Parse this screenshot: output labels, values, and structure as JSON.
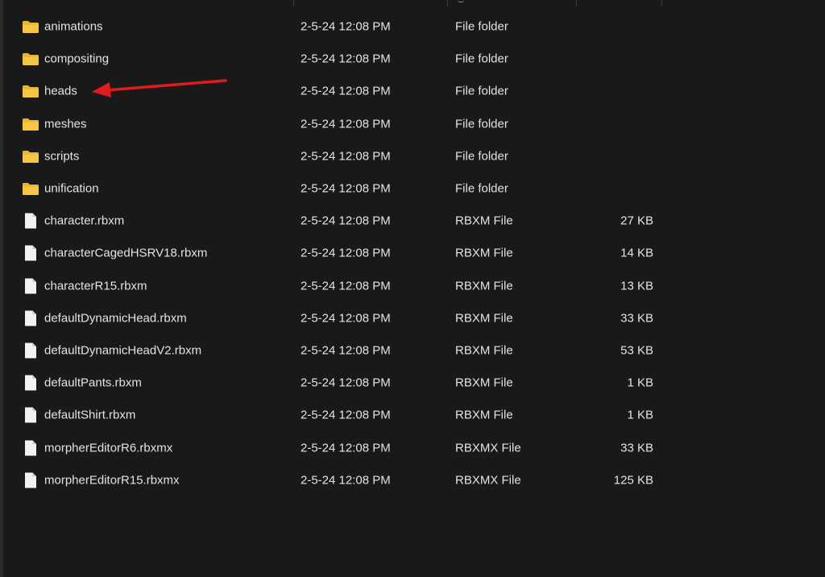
{
  "colors": {
    "background": "#191919",
    "text": "#e3e3e3",
    "folder_icon": "#f3c744",
    "file_icon": "#f2f2f2",
    "annotation_arrow": "#e01b1b"
  },
  "annotation": {
    "type": "arrow",
    "points_to": "heads"
  },
  "files": [
    {
      "name": "animations",
      "date": "2-5-24 12:08 PM",
      "type": "File folder",
      "size": "",
      "icon": "folder-icon"
    },
    {
      "name": "compositing",
      "date": "2-5-24 12:08 PM",
      "type": "File folder",
      "size": "",
      "icon": "folder-icon"
    },
    {
      "name": "heads",
      "date": "2-5-24 12:08 PM",
      "type": "File folder",
      "size": "",
      "icon": "folder-icon"
    },
    {
      "name": "meshes",
      "date": "2-5-24 12:08 PM",
      "type": "File folder",
      "size": "",
      "icon": "folder-icon"
    },
    {
      "name": "scripts",
      "date": "2-5-24 12:08 PM",
      "type": "File folder",
      "size": "",
      "icon": "folder-icon"
    },
    {
      "name": "unification",
      "date": "2-5-24 12:08 PM",
      "type": "File folder",
      "size": "",
      "icon": "folder-icon"
    },
    {
      "name": "character.rbxm",
      "date": "2-5-24 12:08 PM",
      "type": "RBXM File",
      "size": "27 KB",
      "icon": "file-icon"
    },
    {
      "name": "characterCagedHSRV18.rbxm",
      "date": "2-5-24 12:08 PM",
      "type": "RBXM File",
      "size": "14 KB",
      "icon": "file-icon"
    },
    {
      "name": "characterR15.rbxm",
      "date": "2-5-24 12:08 PM",
      "type": "RBXM File",
      "size": "13 KB",
      "icon": "file-icon"
    },
    {
      "name": "defaultDynamicHead.rbxm",
      "date": "2-5-24 12:08 PM",
      "type": "RBXM File",
      "size": "33 KB",
      "icon": "file-icon"
    },
    {
      "name": "defaultDynamicHeadV2.rbxm",
      "date": "2-5-24 12:08 PM",
      "type": "RBXM File",
      "size": "53 KB",
      "icon": "file-icon"
    },
    {
      "name": "defaultPants.rbxm",
      "date": "2-5-24 12:08 PM",
      "type": "RBXM File",
      "size": "1 KB",
      "icon": "file-icon"
    },
    {
      "name": "defaultShirt.rbxm",
      "date": "2-5-24 12:08 PM",
      "type": "RBXM File",
      "size": "1 KB",
      "icon": "file-icon"
    },
    {
      "name": "morpherEditorR6.rbxmx",
      "date": "2-5-24 12:08 PM",
      "type": "RBXMX File",
      "size": "33 KB",
      "icon": "file-icon"
    },
    {
      "name": "morpherEditorR15.rbxmx",
      "date": "2-5-24 12:08 PM",
      "type": "RBXMX File",
      "size": "125 KB",
      "icon": "file-icon"
    }
  ]
}
